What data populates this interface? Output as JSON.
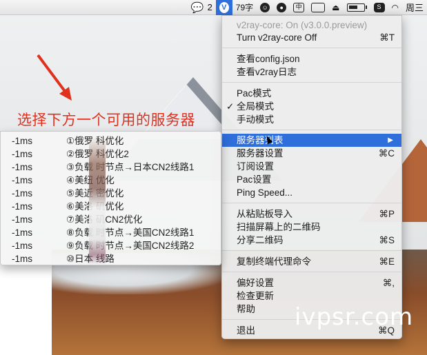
{
  "menubar": {
    "wechat_count": "2",
    "input_label": "79字",
    "ime_label": "中",
    "day": "周三"
  },
  "annotation": {
    "text": "选择下方一个可用的服务器"
  },
  "menu": {
    "items": [
      {
        "label": "v2ray-core: On  (v3.0.0.preview)",
        "shortcut": ""
      },
      {
        "label": "Turn v2ray-core Off",
        "shortcut": "⌘T"
      },
      {
        "label": "查看config.json",
        "shortcut": ""
      },
      {
        "label": "查看v2ray日志",
        "shortcut": ""
      },
      {
        "label": "Pac模式",
        "shortcut": ""
      },
      {
        "label": "全局模式",
        "shortcut": ""
      },
      {
        "label": "手动模式",
        "shortcut": ""
      },
      {
        "label": "服务器列表",
        "shortcut": "▶"
      },
      {
        "label": "服务器设置",
        "shortcut": "⌘C"
      },
      {
        "label": "订阅设置",
        "shortcut": ""
      },
      {
        "label": "Pac设置",
        "shortcut": ""
      },
      {
        "label": "Ping Speed...",
        "shortcut": ""
      },
      {
        "label": "从粘贴板导入",
        "shortcut": "⌘P"
      },
      {
        "label": "扫描屏幕上的二维码",
        "shortcut": ""
      },
      {
        "label": "分享二维码",
        "shortcut": "⌘S"
      },
      {
        "label": "复制终端代理命令",
        "shortcut": "⌘E"
      },
      {
        "label": "偏好设置",
        "shortcut": "⌘,"
      },
      {
        "label": "检查更新",
        "shortcut": ""
      },
      {
        "label": "帮助",
        "shortcut": ""
      },
      {
        "label": "退出",
        "shortcut": "⌘Q"
      }
    ],
    "checked_mark": "✓"
  },
  "submenu": {
    "rows": [
      {
        "latency": "-1ms",
        "name": "①俄罗   科优化"
      },
      {
        "latency": "-1ms",
        "name": "②俄罗   科优化2"
      },
      {
        "latency": "-1ms",
        "name": "③负载   时节点→日本CN2线路1"
      },
      {
        "latency": "-1ms",
        "name": "④美纽   优化"
      },
      {
        "latency": "-1ms",
        "name": "⑤美近   密优化"
      },
      {
        "latency": "-1ms",
        "name": "⑥美洛   矶优化"
      },
      {
        "latency": "-1ms",
        "name": "⑦美洛   矶CN2优化"
      },
      {
        "latency": "-1ms",
        "name": "⑧负载   时节点→美国CN2线路1"
      },
      {
        "latency": "-1ms",
        "name": "⑨负载   时节点→美国CN2线路2"
      },
      {
        "latency": "-1ms",
        "name": "⑩日本        线路"
      }
    ]
  },
  "watermark": {
    "text": "ivpsr.com"
  },
  "colors": {
    "highlight": "#2f6fdb",
    "annotation": "#e0301e"
  }
}
